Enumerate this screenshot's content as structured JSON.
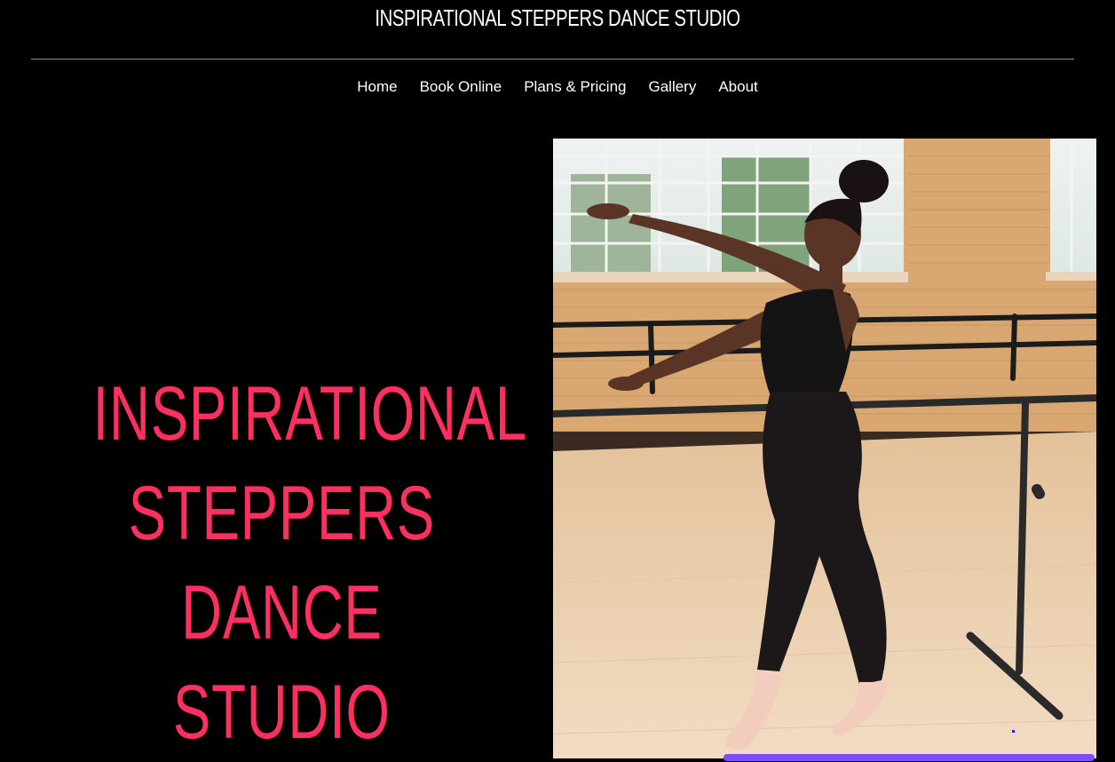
{
  "header": {
    "site_title": "INSPIRATIONAL STEPPERS DANCE STUDIO"
  },
  "nav": {
    "items": [
      {
        "label": "Home"
      },
      {
        "label": "Book Online"
      },
      {
        "label": "Plans & Pricing"
      },
      {
        "label": "Gallery"
      },
      {
        "label": "About"
      }
    ]
  },
  "hero": {
    "heading_lines": [
      "INSPIRATIONAL",
      "STEPPERS DANCE",
      "STUDIO"
    ],
    "photo_icon": "dancer-photo"
  },
  "colors": {
    "background": "#000000",
    "title_text": "#ffffff",
    "hero_heading": "#ff2f5f",
    "divider": "#8c8c8c"
  }
}
